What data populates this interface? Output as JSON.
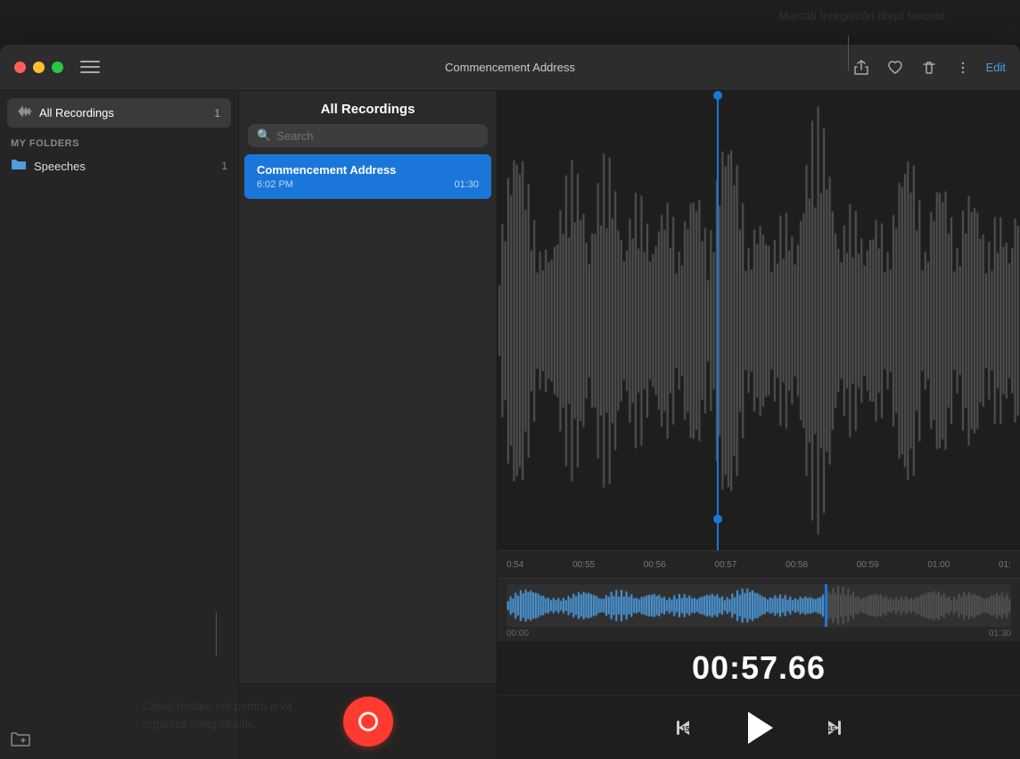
{
  "tooltip_top": "Marcați înregistrări drept favorite.",
  "tooltip_bottom_line1": "Creați dosare noi pentru a vă",
  "tooltip_bottom_line2": "organiza înregistrările.",
  "window": {
    "title": "Commencement Address",
    "traffic_lights": [
      "close",
      "minimize",
      "maximize"
    ],
    "actions": {
      "share": "↑",
      "favorite": "♡",
      "delete": "🗑",
      "options": "≡",
      "edit": "Edit"
    }
  },
  "sidebar": {
    "all_recordings_label": "All Recordings",
    "all_recordings_count": "1",
    "my_folders_label": "My Folders",
    "folders": [
      {
        "name": "Speeches",
        "count": "1"
      }
    ],
    "new_folder_tooltip": "New Folder"
  },
  "recordings_panel": {
    "header": "All Recordings",
    "search_placeholder": "Search",
    "recordings": [
      {
        "title": "Commencement Address",
        "time": "6:02 PM",
        "duration": "01:30",
        "selected": true
      }
    ]
  },
  "player": {
    "current_time": "00:57.66",
    "timeline_labels": [
      "0:54",
      "00:55",
      "00:56",
      "00:57",
      "00:58",
      "00:59",
      "01:00",
      "01:"
    ],
    "mini_start": "00:00",
    "mini_end": "01:30",
    "skip_back_label": "15",
    "skip_forward_label": "15"
  }
}
